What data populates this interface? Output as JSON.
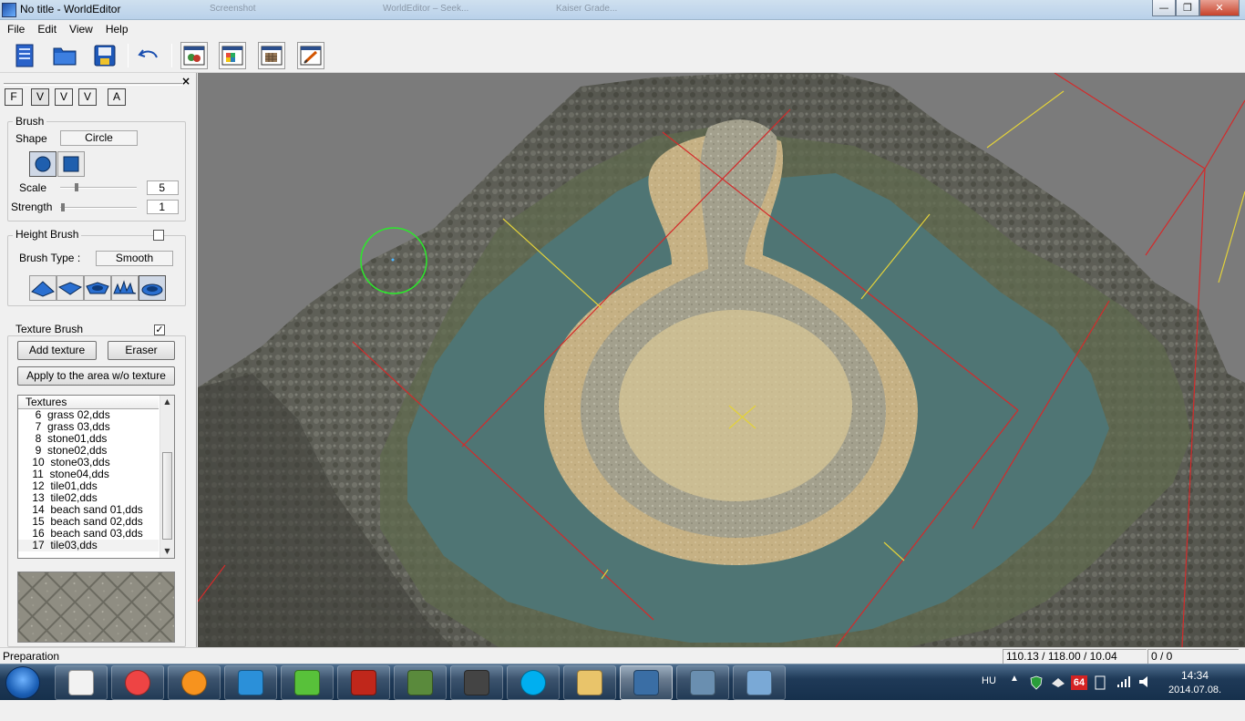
{
  "window": {
    "title": "No title - WorldEditor",
    "background_tabs": [
      "Screenshot",
      "WorldEditor – Seek...",
      "Kaiser Grade..."
    ],
    "minimize": "—",
    "maximize": "❐",
    "close": "✕"
  },
  "menu": [
    "File",
    "Edit",
    "View",
    "Help"
  ],
  "toolbar": {
    "icons": [
      "new-document-icon",
      "open-folder-icon",
      "save-icon",
      "undo-icon",
      "map-view-icon",
      "palette-view-icon",
      "terrain-grid-icon",
      "paint-edit-icon"
    ]
  },
  "panel": {
    "close": "×",
    "tabs": [
      "F",
      "V",
      "V",
      "V",
      "A"
    ],
    "brush": {
      "title": "Brush",
      "shape_label": "Shape",
      "shape_value": "Circle",
      "scale_label": "Scale",
      "scale_value": "5",
      "strength_label": "Strength",
      "strength_value": "1"
    },
    "height_brush": {
      "title": "Height Brush",
      "type_label": "Brush Type :",
      "type_value": "Smooth",
      "checked": false
    },
    "texture_brush": {
      "title": "Texture Brush",
      "checked": true,
      "add_texture": "Add texture",
      "eraser": "Eraser",
      "apply": "Apply to the area w/o texture",
      "list_header": "Textures",
      "textures": [
        "  6  grass 02,dds",
        "  7  grass 03,dds",
        "  8  stone01,dds",
        "  9  stone02,dds",
        " 10  stone03,dds",
        " 11  stone04,dds",
        " 12  tile01,dds",
        " 13  tile02,dds",
        " 14  beach sand 01,dds",
        " 15  beach sand 02,dds",
        " 16  beach sand 03,dds",
        " 17  tile03,dds"
      ],
      "selected_index": 11
    }
  },
  "status": {
    "text": "Preparation",
    "coords": "110.13 / 118.00 / 10.04",
    "counter": "0 / 0"
  },
  "taskbar": {
    "apps": [
      "grid-app-icon",
      "chrome-icon",
      "firefox-icon",
      "media-player-icon",
      "frog-app-icon",
      "filezilla-icon",
      "notepad-icon",
      "sublime-icon",
      "skype-icon",
      "explorer-icon",
      "worldeditor-icon",
      "tortoise-icon",
      "paint-icon"
    ],
    "lang": "HU",
    "badge": "64",
    "time": "14:34",
    "date": "2014.07.08."
  }
}
